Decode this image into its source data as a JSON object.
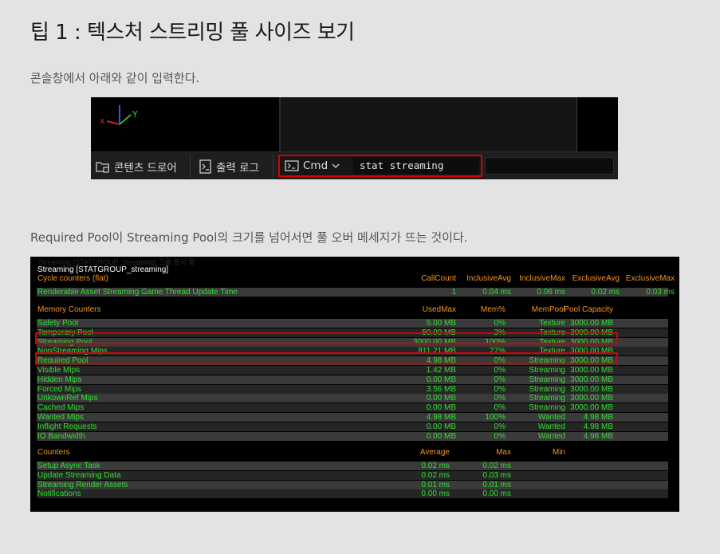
{
  "heading": "팁 1 : 텍스처 스트리밍 풀 사이즈 보기",
  "para1": "콘솔창에서 아래와 같이 입력한다.",
  "para2": "Required Pool이 Streaming Pool의 크기를 넘어서면 풀 오버 메세지가 뜨는 것이다.",
  "console": {
    "axis_x": "x",
    "axis_y": "Y",
    "content_drawer": "콘텐츠 드로어",
    "output_log": "출력 로그",
    "cmd_label": "Cmd",
    "cmd_value": "stat streaming",
    "colors": {
      "highlight": "#d60000"
    }
  },
  "stat": {
    "ghost_text": "Streaming [STATGROUP_streaming] 그룹 표시 중",
    "group_title": "Streaming [STATGROUP_streaming]",
    "cycle": {
      "headers": [
        "Cycle counters (flat)",
        "CallCount",
        "InclusiveAvg",
        "InclusiveMax",
        "ExclusiveAvg",
        "ExclusiveMax"
      ],
      "rows": [
        [
          "Renderable Asset Streaming Game Thread Update Time",
          "1",
          "0.04 ms",
          "0.06 ms",
          "0.02 ms",
          "0.03 ms"
        ]
      ]
    },
    "memory": {
      "headers": [
        "Memory Counters",
        "UsedMax",
        "Mem%",
        "MemPool",
        "Pool Capacity"
      ],
      "rows": [
        [
          "Safety Pool",
          "5.00 MB",
          "0%",
          "Texture",
          "3000.00 MB"
        ],
        [
          "Temporary Pool",
          "50.00 MB",
          "2%",
          "Texture",
          "3000.00 MB"
        ],
        [
          "Streaming Pool",
          "3000.00 MB",
          "100%",
          "Texture",
          "3000.00 MB"
        ],
        [
          "NonStreaming Mips",
          "811.21 MB",
          "27%",
          "Texture",
          "3000.00 MB"
        ],
        [
          "Required Pool",
          "4.98 MB",
          "0%",
          "Streaming",
          "3000.00 MB"
        ],
        [
          "Visible Mips",
          "1.42 MB",
          "0%",
          "Streaming",
          "3000.00 MB"
        ],
        [
          "Hidden Mips",
          "0.00 MB",
          "0%",
          "Streaming",
          "3000.00 MB"
        ],
        [
          "Forced Mips",
          "3.56 MB",
          "0%",
          "Streaming",
          "3000.00 MB"
        ],
        [
          "UnkownRef Mips",
          "0.00 MB",
          "0%",
          "Streaming",
          "3000.00 MB"
        ],
        [
          "Cached Mips",
          "0.00 MB",
          "0%",
          "Streaming",
          "3000.00 MB"
        ],
        [
          "Wanted Mips",
          "4.98 MB",
          "100%",
          "Wanted",
          "4.98 MB"
        ],
        [
          "Inflight Requests",
          "0.00 MB",
          "0%",
          "Wanted",
          "4.98 MB"
        ],
        [
          "IO Bandwidth",
          "0.00 MB",
          "0%",
          "Wanted",
          "4.98 MB"
        ]
      ]
    },
    "counters": {
      "headers": [
        "Counters",
        "Average",
        "Max",
        "Min"
      ],
      "rows": [
        [
          "Setup Async Task",
          "0.02 ms",
          "0.02 ms",
          ""
        ],
        [
          "Update Streaming Data",
          "0.02 ms",
          "0.03 ms",
          ""
        ],
        [
          "Streaming Render Assets",
          "0.01 ms",
          "0.01 ms",
          ""
        ],
        [
          "Notifications",
          "0.00 ms",
          "0.00 ms",
          ""
        ]
      ]
    },
    "colors": {
      "header": "#f39321",
      "value": "#2ee02e",
      "highlight": "#d60000"
    }
  }
}
